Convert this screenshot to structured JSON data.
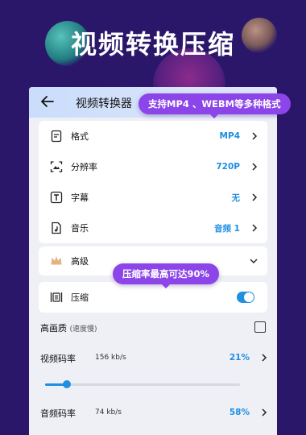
{
  "promo": {
    "headline": "视频转换压缩"
  },
  "header": {
    "title": "视频转换器"
  },
  "tooltips": {
    "formats": "支持MP4 、WEBM等多种格式",
    "compression": "压缩率最高可达90%"
  },
  "settings": [
    {
      "label": "格式",
      "value": "MP4",
      "icon": "file-format-icon"
    },
    {
      "label": "分辨率",
      "value": "720P",
      "icon": "resolution-icon"
    },
    {
      "label": "字幕",
      "value": "无",
      "icon": "subtitle-icon"
    },
    {
      "label": "音乐",
      "value": "音频 1",
      "icon": "music-icon"
    }
  ],
  "advanced": {
    "label": "高级",
    "icon": "crown-icon"
  },
  "compress": {
    "label": "压缩",
    "icon": "compress-icon",
    "enabled": true
  },
  "high_quality": {
    "label": "高画质",
    "note": "(速度慢)",
    "checked": false
  },
  "video_bitrate": {
    "label": "视频码率",
    "rate": "156 kb/s",
    "percent": "21%",
    "level": 0.11
  },
  "audio_bitrate": {
    "label": "音频码率",
    "rate": "74 kb/s",
    "percent": "58%"
  },
  "colors": {
    "accent": "#1f8fe0",
    "tooltip": "#8b45e8",
    "background": "#2a1769"
  }
}
